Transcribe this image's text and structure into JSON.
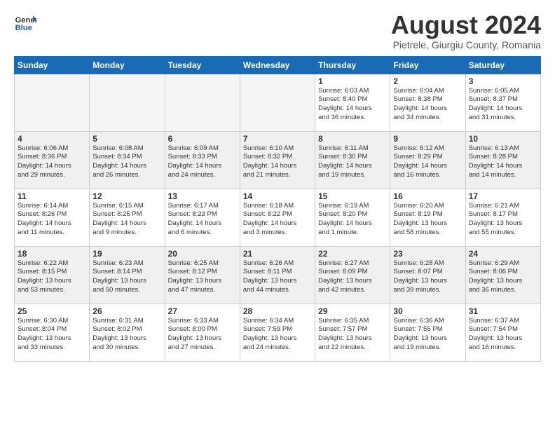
{
  "logo": {
    "general": "General",
    "blue": "Blue"
  },
  "title": "August 2024",
  "subtitle": "Pietrele, Giurgiu County, Romania",
  "days_header": [
    "Sunday",
    "Monday",
    "Tuesday",
    "Wednesday",
    "Thursday",
    "Friday",
    "Saturday"
  ],
  "weeks": [
    [
      {
        "day": "",
        "info": ""
      },
      {
        "day": "",
        "info": ""
      },
      {
        "day": "",
        "info": ""
      },
      {
        "day": "",
        "info": ""
      },
      {
        "day": "1",
        "info": "Sunrise: 6:03 AM\nSunset: 8:40 PM\nDaylight: 14 hours\nand 36 minutes."
      },
      {
        "day": "2",
        "info": "Sunrise: 6:04 AM\nSunset: 8:38 PM\nDaylight: 14 hours\nand 34 minutes."
      },
      {
        "day": "3",
        "info": "Sunrise: 6:05 AM\nSunset: 8:37 PM\nDaylight: 14 hours\nand 31 minutes."
      }
    ],
    [
      {
        "day": "4",
        "info": "Sunrise: 6:06 AM\nSunset: 8:36 PM\nDaylight: 14 hours\nand 29 minutes."
      },
      {
        "day": "5",
        "info": "Sunrise: 6:08 AM\nSunset: 8:34 PM\nDaylight: 14 hours\nand 26 minutes."
      },
      {
        "day": "6",
        "info": "Sunrise: 6:09 AM\nSunset: 8:33 PM\nDaylight: 14 hours\nand 24 minutes."
      },
      {
        "day": "7",
        "info": "Sunrise: 6:10 AM\nSunset: 8:32 PM\nDaylight: 14 hours\nand 21 minutes."
      },
      {
        "day": "8",
        "info": "Sunrise: 6:11 AM\nSunset: 8:30 PM\nDaylight: 14 hours\nand 19 minutes."
      },
      {
        "day": "9",
        "info": "Sunrise: 6:12 AM\nSunset: 8:29 PM\nDaylight: 14 hours\nand 16 minutes."
      },
      {
        "day": "10",
        "info": "Sunrise: 6:13 AM\nSunset: 8:28 PM\nDaylight: 14 hours\nand 14 minutes."
      }
    ],
    [
      {
        "day": "11",
        "info": "Sunrise: 6:14 AM\nSunset: 8:26 PM\nDaylight: 14 hours\nand 11 minutes."
      },
      {
        "day": "12",
        "info": "Sunrise: 6:15 AM\nSunset: 8:25 PM\nDaylight: 14 hours\nand 9 minutes."
      },
      {
        "day": "13",
        "info": "Sunrise: 6:17 AM\nSunset: 8:23 PM\nDaylight: 14 hours\nand 6 minutes."
      },
      {
        "day": "14",
        "info": "Sunrise: 6:18 AM\nSunset: 8:22 PM\nDaylight: 14 hours\nand 3 minutes."
      },
      {
        "day": "15",
        "info": "Sunrise: 6:19 AM\nSunset: 8:20 PM\nDaylight: 14 hours\nand 1 minute."
      },
      {
        "day": "16",
        "info": "Sunrise: 6:20 AM\nSunset: 8:19 PM\nDaylight: 13 hours\nand 58 minutes."
      },
      {
        "day": "17",
        "info": "Sunrise: 6:21 AM\nSunset: 8:17 PM\nDaylight: 13 hours\nand 55 minutes."
      }
    ],
    [
      {
        "day": "18",
        "info": "Sunrise: 6:22 AM\nSunset: 8:15 PM\nDaylight: 13 hours\nand 53 minutes."
      },
      {
        "day": "19",
        "info": "Sunrise: 6:23 AM\nSunset: 8:14 PM\nDaylight: 13 hours\nand 50 minutes."
      },
      {
        "day": "20",
        "info": "Sunrise: 6:25 AM\nSunset: 8:12 PM\nDaylight: 13 hours\nand 47 minutes."
      },
      {
        "day": "21",
        "info": "Sunrise: 6:26 AM\nSunset: 8:11 PM\nDaylight: 13 hours\nand 44 minutes."
      },
      {
        "day": "22",
        "info": "Sunrise: 6:27 AM\nSunset: 8:09 PM\nDaylight: 13 hours\nand 42 minutes."
      },
      {
        "day": "23",
        "info": "Sunrise: 6:28 AM\nSunset: 8:07 PM\nDaylight: 13 hours\nand 39 minutes."
      },
      {
        "day": "24",
        "info": "Sunrise: 6:29 AM\nSunset: 8:06 PM\nDaylight: 13 hours\nand 36 minutes."
      }
    ],
    [
      {
        "day": "25",
        "info": "Sunrise: 6:30 AM\nSunset: 8:04 PM\nDaylight: 13 hours\nand 33 minutes."
      },
      {
        "day": "26",
        "info": "Sunrise: 6:31 AM\nSunset: 8:02 PM\nDaylight: 13 hours\nand 30 minutes."
      },
      {
        "day": "27",
        "info": "Sunrise: 6:33 AM\nSunset: 8:00 PM\nDaylight: 13 hours\nand 27 minutes."
      },
      {
        "day": "28",
        "info": "Sunrise: 6:34 AM\nSunset: 7:59 PM\nDaylight: 13 hours\nand 24 minutes."
      },
      {
        "day": "29",
        "info": "Sunrise: 6:35 AM\nSunset: 7:57 PM\nDaylight: 13 hours\nand 22 minutes."
      },
      {
        "day": "30",
        "info": "Sunrise: 6:36 AM\nSunset: 7:55 PM\nDaylight: 13 hours\nand 19 minutes."
      },
      {
        "day": "31",
        "info": "Sunrise: 6:37 AM\nSunset: 7:54 PM\nDaylight: 13 hours\nand 16 minutes."
      }
    ]
  ]
}
